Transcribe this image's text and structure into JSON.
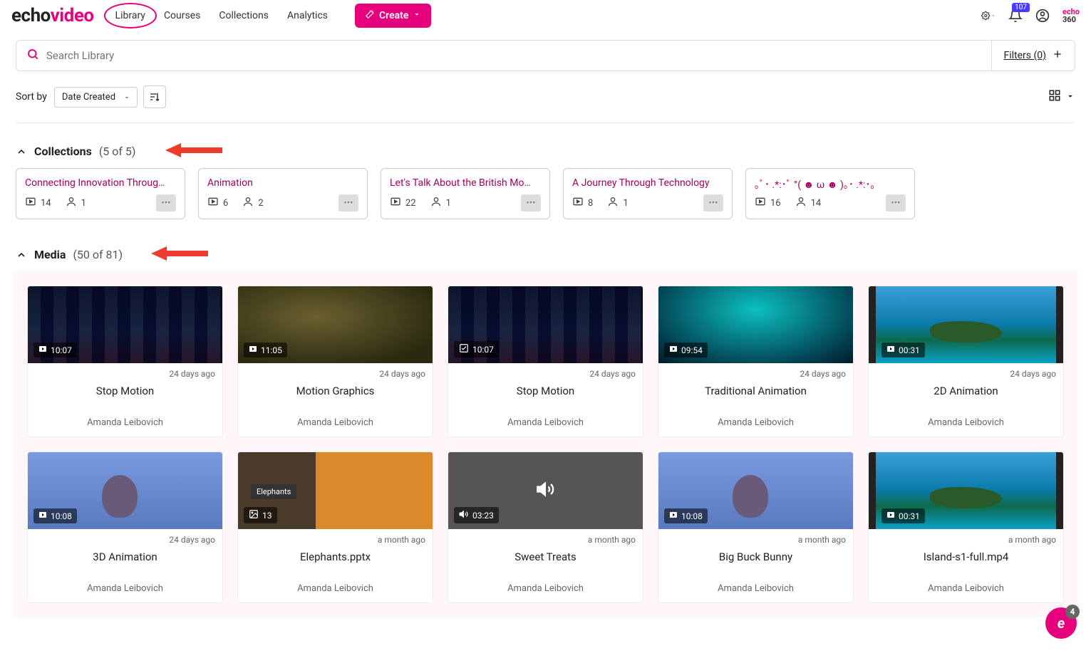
{
  "brand": {
    "part1": "echo",
    "part2": "video",
    "small1": "echo",
    "small2": "360"
  },
  "nav": {
    "library": "Library",
    "courses": "Courses",
    "collections": "Collections",
    "analytics": "Analytics"
  },
  "create_label": "Create",
  "notif_count": "107",
  "search_placeholder": "Search Library",
  "filters_label": "Filters (0)",
  "sort_label": "Sort by",
  "sort_value": "Date Created",
  "sections": {
    "collections_title": "Collections",
    "collections_count": "(5 of 5)",
    "media_title": "Media",
    "media_count": "(50 of 81)"
  },
  "collections": [
    {
      "title": "Connecting Innovation Throug…",
      "media": "14",
      "users": "1"
    },
    {
      "title": "Animation",
      "media": "6",
      "users": "2"
    },
    {
      "title": "Let's Talk About the British Mo…",
      "media": "22",
      "users": "1"
    },
    {
      "title": "A Journey Through Technology",
      "media": "8",
      "users": "1"
    },
    {
      "title": "｡ﾟ･ .*:･ﾟ   °( ☻ ω ☻ )｡･  .*:･｡",
      "media": "16",
      "users": "14"
    }
  ],
  "media": [
    {
      "title": "Stop Motion",
      "dur": "10:07",
      "date": "24 days ago",
      "author": "Amanda Leibovich",
      "thumb": "bg-night",
      "icon": "play"
    },
    {
      "title": "Motion Graphics",
      "dur": "11:05",
      "date": "24 days ago",
      "author": "Amanda Leibovich",
      "thumb": "bg-wall",
      "icon": "play"
    },
    {
      "title": "Stop Motion",
      "dur": "10:07",
      "date": "24 days ago",
      "author": "Amanda Leibovich",
      "thumb": "bg-night",
      "icon": "quiz"
    },
    {
      "title": "Traditional Animation",
      "dur": "09:54",
      "date": "24 days ago",
      "author": "Amanda Leibovich",
      "thumb": "bg-sea",
      "icon": "play"
    },
    {
      "title": "2D Animation",
      "dur": "00:31",
      "date": "24 days ago",
      "author": "Amanda Leibovich",
      "thumb": "bg-island",
      "icon": "play"
    },
    {
      "title": "3D Animation",
      "dur": "10:08",
      "date": "24 days ago",
      "author": "Amanda Leibovich",
      "thumb": "bg-owl",
      "icon": "play"
    },
    {
      "title": "Elephants.pptx",
      "dur": "13",
      "date": "a month ago",
      "author": "Amanda Leibovich",
      "thumb": "bg-eleph",
      "icon": "image"
    },
    {
      "title": "Sweet Treats",
      "dur": "03:23",
      "date": "a month ago",
      "author": "Amanda Leibovich",
      "thumb": "bg-gray",
      "icon": "audio"
    },
    {
      "title": "Big Buck Bunny",
      "dur": "10:08",
      "date": "a month ago",
      "author": "Amanda Leibovich",
      "thumb": "bg-owl",
      "icon": "play"
    },
    {
      "title": "Island-s1-full.mp4",
      "dur": "00:31",
      "date": "a month ago",
      "author": "Amanda Leibovich",
      "thumb": "bg-island",
      "icon": "play"
    }
  ],
  "eleph_label": "Elephants",
  "fab_count": "4"
}
